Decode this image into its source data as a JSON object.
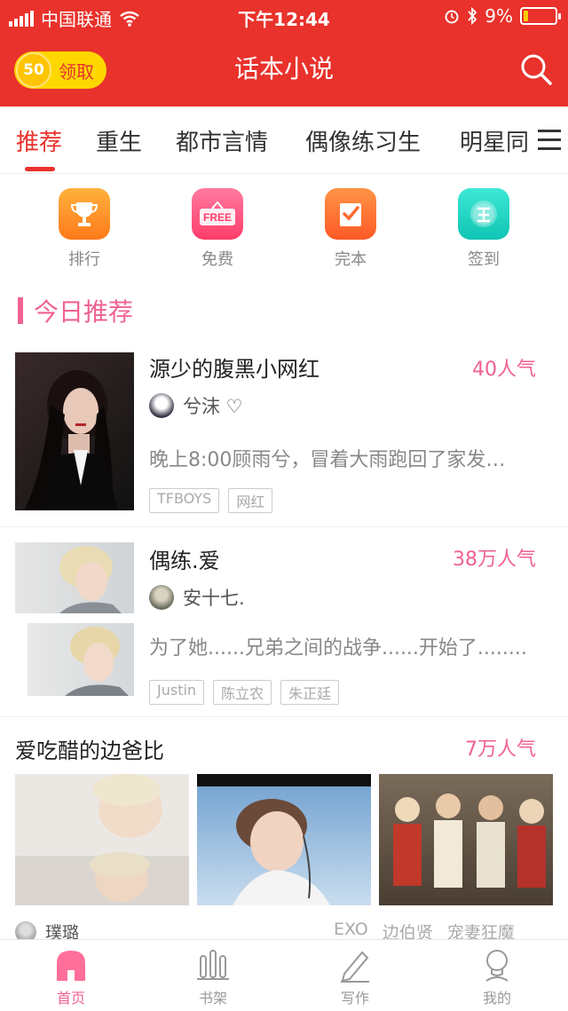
{
  "status_bar": {
    "carrier": "中国联通",
    "time": "下午12:44",
    "battery": "9%"
  },
  "nav": {
    "coin_count": "50",
    "coin_label": "领取",
    "title": "话本小说"
  },
  "tabs": [
    {
      "label": "推荐",
      "active": true
    },
    {
      "label": "重生",
      "active": false
    },
    {
      "label": "都市言情",
      "active": false
    },
    {
      "label": "偶像练习生",
      "active": false
    },
    {
      "label": "明星同人",
      "active": false
    }
  ],
  "quick_links": [
    {
      "label": "排行",
      "icon": "trophy-icon",
      "color": "#ff8a1f"
    },
    {
      "label": "免费",
      "icon": "free-sign-icon",
      "color": "#ff4f7a"
    },
    {
      "label": "完本",
      "icon": "checkbox-icon",
      "color": "#ff6a2f"
    },
    {
      "label": "签到",
      "icon": "sign-in-icon",
      "color": "#1dd6c4"
    }
  ],
  "section": {
    "title": "今日推荐",
    "accent": "#f06292"
  },
  "books": [
    {
      "title": "源少的腹黑小网红",
      "popularity": "40人气",
      "author": "兮沫 ♡",
      "description": "晚上8:00顾雨兮，冒着大雨跑回了家发…",
      "tags": [
        "TFBOYS",
        "网红"
      ]
    },
    {
      "title": "偶练.爱",
      "popularity": "38万人气",
      "author": "安十七.",
      "description": "为了她......兄弟之间的战争......开始了........",
      "tags": [
        "Justin",
        "陈立农",
        "朱正廷"
      ]
    },
    {
      "title": "爱吃醋的边爸比",
      "popularity": "7万人气",
      "author": "璞璐",
      "tags": [
        "EXO",
        "边伯贤",
        "宠妻狂魔"
      ]
    }
  ],
  "tabbar": [
    {
      "label": "首页",
      "icon": "home-icon",
      "active": true
    },
    {
      "label": "书架",
      "icon": "bookshelf-icon",
      "active": false
    },
    {
      "label": "写作",
      "icon": "pen-icon",
      "active": false
    },
    {
      "label": "我的",
      "icon": "profile-icon",
      "active": false
    }
  ]
}
